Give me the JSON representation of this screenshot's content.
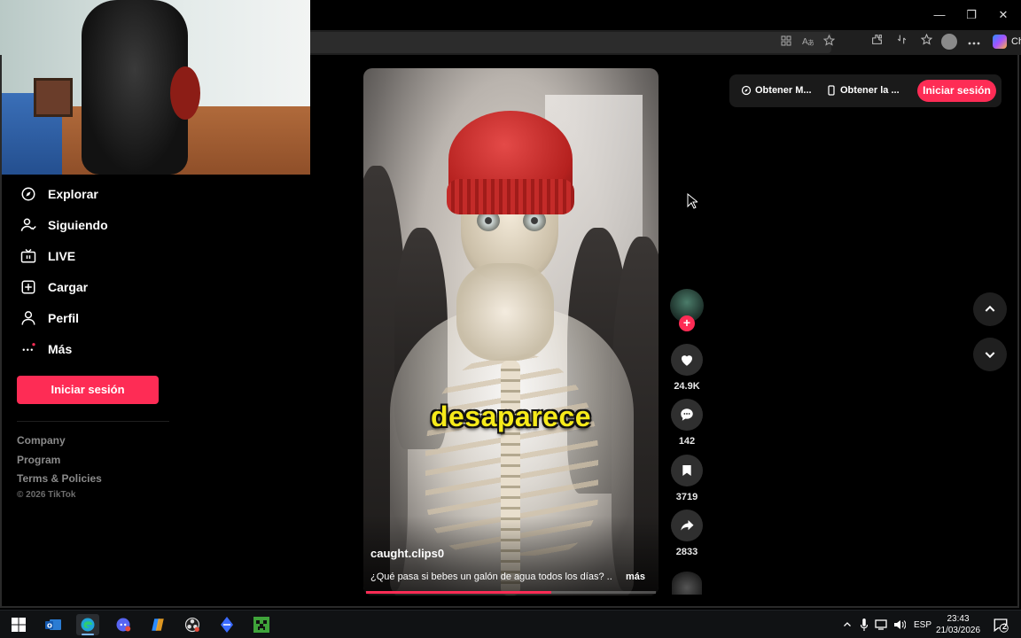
{
  "browser": {
    "window_controls": {
      "minimize": "—",
      "restore": "❐",
      "close": "✕"
    },
    "copilot_label": "Chat"
  },
  "sidebar": {
    "items": [
      {
        "label": "Explorar",
        "icon": "compass-icon"
      },
      {
        "label": "Siguiendo",
        "icon": "user-follow-icon"
      },
      {
        "label": "LIVE",
        "icon": "live-tv-icon"
      },
      {
        "label": "Cargar",
        "icon": "upload-plus-icon"
      },
      {
        "label": "Perfil",
        "icon": "person-icon"
      },
      {
        "label": "Más",
        "icon": "more-dots-icon"
      }
    ],
    "login_label": "Iniciar sesión",
    "footer_links": [
      "Company",
      "Program",
      "Terms & Policies"
    ],
    "copyright": "© 2026 TikTok"
  },
  "header": {
    "get_app_label": "Obtener M...",
    "get_mobile_label": "Obtener la ...",
    "login_label": "Iniciar sesión"
  },
  "video": {
    "caption": "desaparece",
    "author": "caught.clips0",
    "description": "¿Qué pasa si bebes un galón de agua todos los días? ..",
    "more_label": "más",
    "progress": 0.64
  },
  "actions": {
    "follow_symbol": "+",
    "likes": "24.9K",
    "comments": "142",
    "saves": "3719",
    "shares": "2833"
  },
  "colors": {
    "accent": "#fe2c55",
    "caption_yellow": "#f6ea1a",
    "background": "#000000"
  },
  "taskbar": {
    "language": "ESP",
    "time": "23:43",
    "date": "21/03/2026",
    "notification_count": "2"
  }
}
